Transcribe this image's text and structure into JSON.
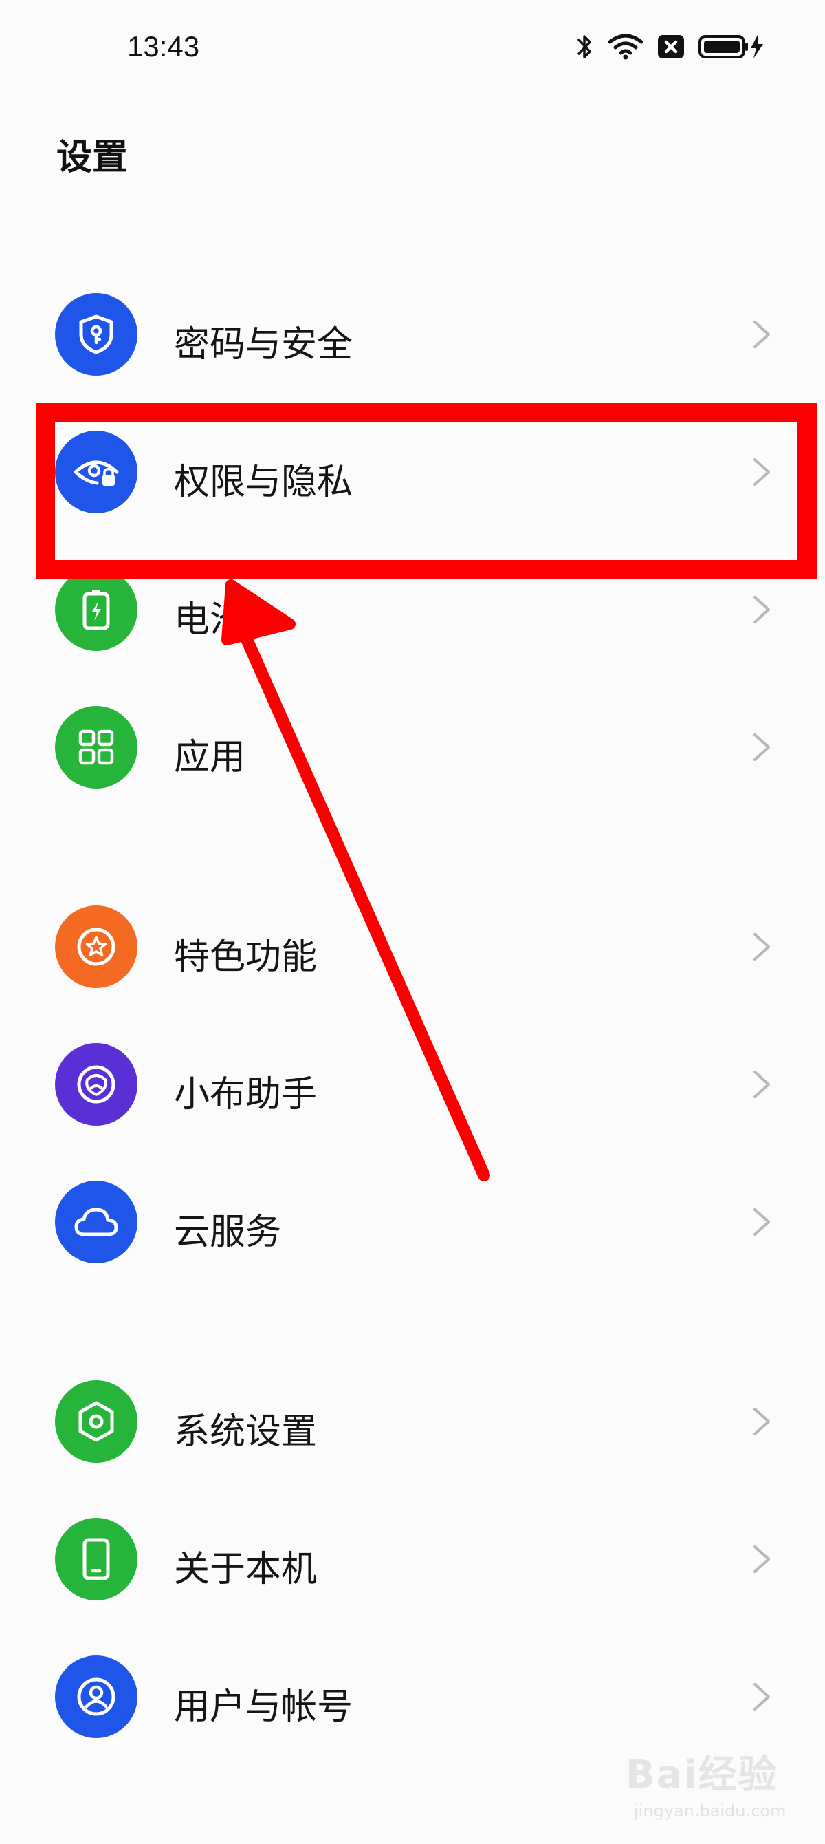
{
  "status_bar": {
    "time": "13:43",
    "icons": [
      "bluetooth-icon",
      "wifi-icon",
      "sim-off-icon",
      "battery-charging-icon"
    ]
  },
  "page": {
    "title": "设置"
  },
  "settings_groups": [
    {
      "items": [
        {
          "label": "密码与安全",
          "icon": "shield-key-icon",
          "color": "#1f55e8"
        },
        {
          "label": "权限与隐私",
          "icon": "eye-lock-icon",
          "color": "#1f55e8"
        },
        {
          "label": "电池",
          "icon": "battery-icon",
          "color": "#27b43a"
        },
        {
          "label": "应用",
          "icon": "apps-grid-icon",
          "color": "#27b43a"
        }
      ]
    },
    {
      "items": [
        {
          "label": "特色功能",
          "icon": "star-circle-icon",
          "color": "#f56a22"
        },
        {
          "label": "小布助手",
          "icon": "assistant-icon",
          "color": "#5b2fd6"
        },
        {
          "label": "云服务",
          "icon": "cloud-icon",
          "color": "#1f55e8"
        }
      ]
    },
    {
      "items": [
        {
          "label": "系统设置",
          "icon": "hexagon-gear-icon",
          "color": "#27b43a"
        },
        {
          "label": "关于本机",
          "icon": "phone-device-icon",
          "color": "#27b43a"
        },
        {
          "label": "用户与帐号",
          "icon": "user-circle-icon",
          "color": "#1f55e8"
        }
      ]
    }
  ],
  "annotation": {
    "highlighted_item": "权限与隐私",
    "highlight_color": "#fb0000"
  },
  "watermark": {
    "brand": "Bai经验",
    "url": "jingyan.baidu.com"
  }
}
